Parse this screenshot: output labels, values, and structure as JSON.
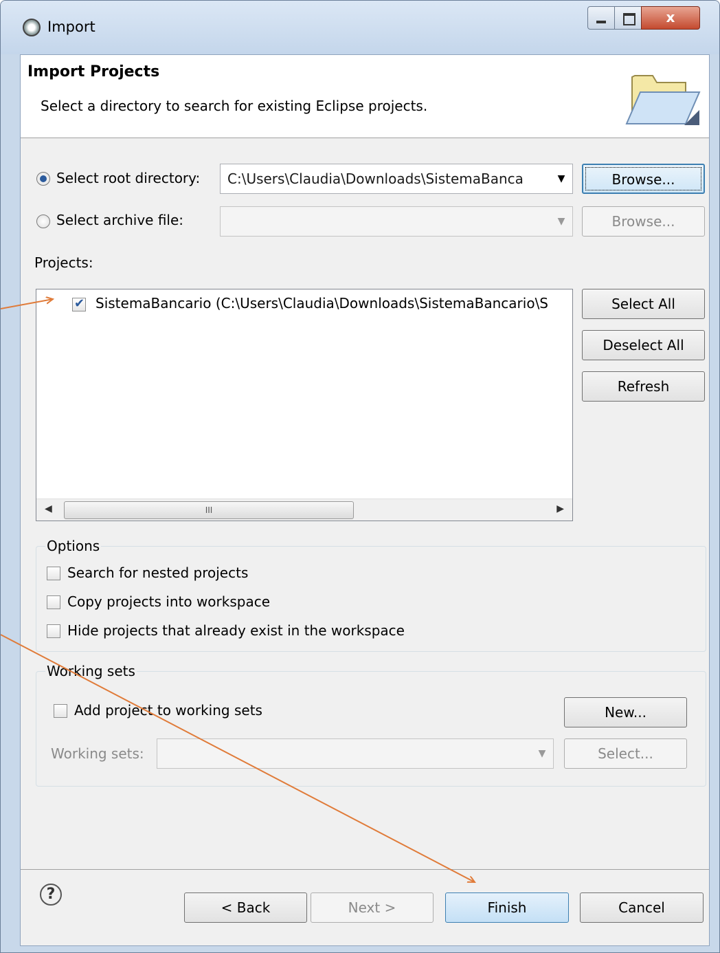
{
  "window": {
    "title": "Import",
    "close_label": "x"
  },
  "header": {
    "title": "Import Projects",
    "description": "Select a directory to search for existing Eclipse projects."
  },
  "source": {
    "root_radio_label": "Select root directory:",
    "root_value": "C:\\Users\\Claudia\\Downloads\\SistemaBanca",
    "root_selected": true,
    "archive_radio_label": "Select archive file:",
    "archive_value": "",
    "browse_label": "Browse..."
  },
  "projects": {
    "label": "Projects:",
    "items": [
      {
        "label": "SistemaBancario (C:\\Users\\Claudia\\Downloads\\SistemaBancario\\S",
        "checked": true
      }
    ],
    "select_all_label": "Select All",
    "deselect_all_label": "Deselect All",
    "refresh_label": "Refresh",
    "scroll_thumb_label": "III"
  },
  "options": {
    "title": "Options",
    "items": [
      {
        "label": "Search for nested projects",
        "checked": false
      },
      {
        "label": "Copy projects into workspace",
        "checked": false
      },
      {
        "label": "Hide projects that already exist in the workspace",
        "checked": false
      }
    ]
  },
  "working_sets": {
    "title": "Working sets",
    "add_label": "Add project to working sets",
    "add_checked": false,
    "new_label": "New...",
    "sets_label": "Working sets:",
    "select_label": "Select..."
  },
  "footer": {
    "help_glyph": "?",
    "back_label": "< Back",
    "next_label": "Next >",
    "finish_label": "Finish",
    "cancel_label": "Cancel"
  },
  "colors": {
    "annotation_arrow": "#e07b39",
    "accent": "#3c7fb1"
  }
}
